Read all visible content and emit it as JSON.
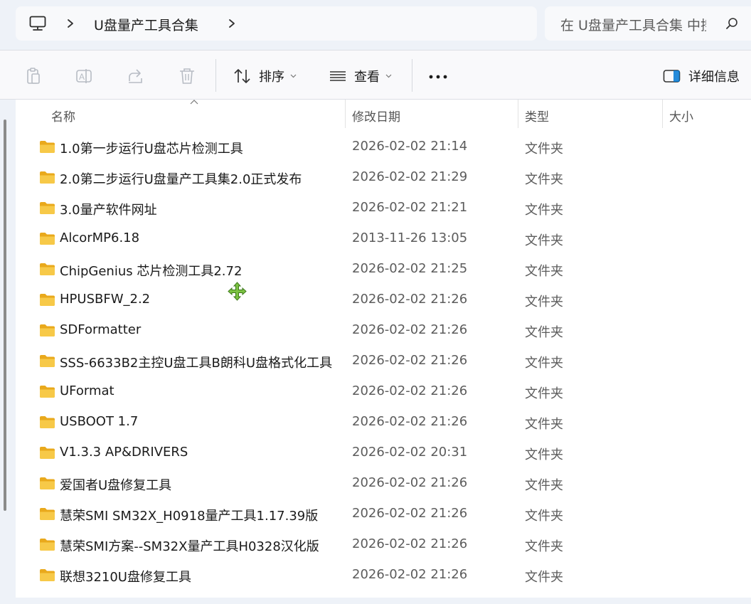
{
  "address_bar": {
    "breadcrumb": "U盘量产工具合集",
    "icons": [
      "this-pc-icon",
      "chevron-right-icon"
    ]
  },
  "search": {
    "placeholder": "在 U盘量产工具合集 中搜索"
  },
  "toolbar": {
    "icons": [
      "copy-icon",
      "rename-icon",
      "share-icon",
      "delete-icon"
    ],
    "sort_label": "排序",
    "view_label": "查看",
    "more_label": "more-options-icon",
    "details_label": "详细信息"
  },
  "columns": {
    "name": "名称",
    "date": "修改日期",
    "type": "类型",
    "size": "大小"
  },
  "accent_color": "#0078d4",
  "folder_color": "#f7c948",
  "cursor": "move-cursor-icon",
  "files": [
    {
      "name": "1.0第一步运行U盘芯片检测工具",
      "date": "2026-02-02 21:14",
      "type": "文件夹"
    },
    {
      "name": "2.0第二步运行U盘量产工具集2.0正式发布",
      "date": "2026-02-02 21:29",
      "type": "文件夹"
    },
    {
      "name": "3.0量产软件网址",
      "date": "2026-02-02 21:21",
      "type": "文件夹"
    },
    {
      "name": "AlcorMP6.18",
      "date": "2013-11-26 13:05",
      "type": "文件夹"
    },
    {
      "name": "ChipGenius 芯片检测工具2.72",
      "date": "2026-02-02 21:25",
      "type": "文件夹"
    },
    {
      "name": "HPUSBFW_2.2",
      "date": "2026-02-02 21:26",
      "type": "文件夹"
    },
    {
      "name": "SDFormatter",
      "date": "2026-02-02 21:26",
      "type": "文件夹"
    },
    {
      "name": "SSS-6633B2主控U盘工具B朗科U盘格式化工具",
      "date": "2026-02-02 21:26",
      "type": "文件夹"
    },
    {
      "name": "UFormat",
      "date": "2026-02-02 21:26",
      "type": "文件夹"
    },
    {
      "name": "USBOOT 1.7",
      "date": "2026-02-02 21:26",
      "type": "文件夹"
    },
    {
      "name": "V1.3.3 AP&DRIVERS",
      "date": "2026-02-02 20:31",
      "type": "文件夹"
    },
    {
      "name": "爱国者U盘修复工具",
      "date": "2026-02-02 21:26",
      "type": "文件夹"
    },
    {
      "name": "慧荣SMI SM32X_H0918量产工具1.17.39版",
      "date": "2026-02-02 21:26",
      "type": "文件夹"
    },
    {
      "name": "慧荣SMI方案--SM32X量产工具H0328汉化版",
      "date": "2026-02-02 21:26",
      "type": "文件夹"
    },
    {
      "name": "联想3210U盘修复工具",
      "date": "2026-02-02 21:26",
      "type": "文件夹"
    }
  ]
}
